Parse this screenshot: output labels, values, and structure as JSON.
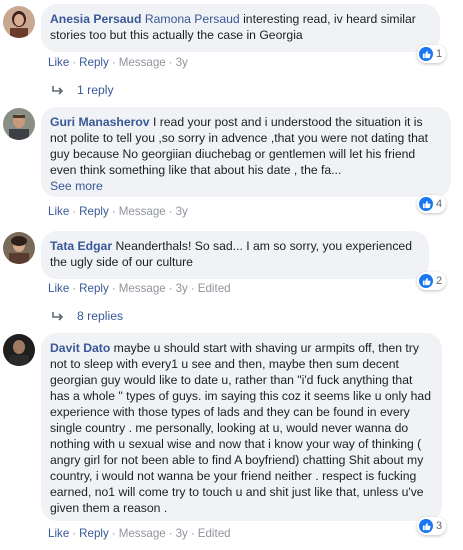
{
  "comments": [
    {
      "author": "Anesia Persaud",
      "tagged": "Ramona Persaud",
      "text": "interesting read, iv heard similar stories too but this actually the case in Georgia",
      "actions": {
        "like": "Like",
        "reply": "Reply",
        "message": "Message",
        "time": "3y"
      },
      "reaction_count": "1",
      "replies_label": "1 reply"
    },
    {
      "author": "Guri Manasherov",
      "text": "I read your post and i understood the situation it is not polite to tell you ,so sorry in advence ,that you were not dating that guy because No georgiian diuchebag or gentlemen will let his friend even think something like that about his date , the fa...",
      "see_more": "See more",
      "actions": {
        "like": "Like",
        "reply": "Reply",
        "message": "Message",
        "time": "3y"
      },
      "reaction_count": "4"
    },
    {
      "author": "Tata Edgar",
      "text": "Neanderthals! So sad... I am so sorry, you experienced the ugly side of our culture",
      "actions": {
        "like": "Like",
        "reply": "Reply",
        "message": "Message",
        "time": "3y",
        "edited": "Edited"
      },
      "reaction_count": "2",
      "replies_label": "8 replies"
    },
    {
      "author": "Davit Dato",
      "text": "maybe u should start with shaving ur armpits off, then try not to sleep with every1 u see and then, maybe then sum decent georgian guy would like to date u, rather than \"i'd fuck anything that has a whole \" types of guys. im saying this coz it seems like u only had experience with those types of lads and they can be found in every single country . me personally, looking at u, would never wanna do nothing with u sexual wise and now that i know your way of thinking ( angry girl for not been able to find A boyfriend) chatting Shit about my country, i would not wanna be your friend neither . respect is fucking earned, no1 will come try to touch u and shit just like that, unless u've given them a reason .",
      "actions": {
        "like": "Like",
        "reply": "Reply",
        "message": "Message",
        "time": "3y",
        "edited": "Edited"
      },
      "reaction_count": "3"
    }
  ],
  "colors": {
    "link": "#385898",
    "bubble": "#f0f2f5",
    "like_blue": "#1877f2"
  },
  "icons": [
    "like-thumb-icon",
    "reply-arrow-icon"
  ]
}
